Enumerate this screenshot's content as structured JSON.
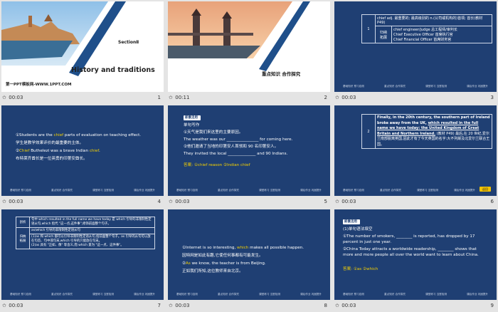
{
  "thumbnails": [
    {
      "time": "00:03",
      "num": "1"
    },
    {
      "time": "00:11",
      "num": "2"
    },
    {
      "time": "00:03",
      "num": "3"
    },
    {
      "time": "00:03",
      "num": "4"
    },
    {
      "time": "00:03",
      "num": "5"
    },
    {
      "time": "00:03",
      "num": "6"
    },
    {
      "time": "00:03",
      "num": "7"
    },
    {
      "time": "00:03",
      "num": "8"
    },
    {
      "time": "00:03",
      "num": "9"
    }
  ],
  "slide1": {
    "section": "SectionⅡ",
    "title": "History and traditions",
    "footer": "第一PPT模板网-WWW.1PPT.COM"
  },
  "slide2": {
    "caption": "重点知识  合作探究"
  },
  "slide3": {
    "row_num": "1",
    "col_label": "归纳\n拓展",
    "line1": "chief adj. 最重要的; 最高级别的   n.(公司或机构的)首领; 首长(教材 P49)",
    "line2": "chief engineer/judge 总工程师/审判长",
    "line3": "Chief Executive Officer 首席执行官",
    "line4": "Chief Financial Officer 首席财务官"
  },
  "slide4": {
    "l1a": "①Students are the ",
    "l1b": "chief",
    "l1c": " parts of evaluation on teaching effect.",
    "l2": "学生是教学效果评价的最重要的主体。",
    "l3a": "②",
    "l3b": "Chief",
    "l3c": " Buthelezi was a brave Indian ",
    "l3d": "chief",
    ".": "",
    "l3e": ".",
    "l4": "布特莱齐酋长是一位英勇的印第安酋长。"
  },
  "slide5": {
    "tag": "即景活用",
    "h": "单句写作",
    "l1": "①天气是我们来这里的主要原因。",
    "l2": "The weather was our ________________ for coming here.",
    "l3": "②他们邀请了当地的印第安人首领和 90 名印第安人。",
    "l4": "They invited the local ______________ and 90 Indians.",
    "ans_label": "答案:",
    "ans": "①chief reason   ②Indian chief"
  },
  "slide6": {
    "row_num": "2",
    "p1": "Finally, in the 20th century, the southern part of Ireland broke away from the UK,",
    "p2": "which resulted in the full name we have today: the United Kingdom of Great Britain and Northern Ireland.",
    "p3": "(教材 P49)",
    "p4": "最后,在 20 世纪,爱尔兰南部脱离英国,因此才有了今天英国的名字:大不列颠及北爱尔兰联合王国。",
    "btn": "返回"
  },
  "slide7": {
    "lab1": "剖析",
    "t1": "句中 which resulted in the full name we have today 是 which 引导的非限制性定语从句,which 指代 \"这一点,这件事\",修饰前面整个句子。",
    "t2": "as/which 引导的非限制性定语从句",
    "lab2": "归纳\n拓展",
    "t3": "(1)as 和 which 都可以引导非限制性定语从句,指前面整个句子。as 引导的从句可以放在句首、句中或句末,which 引导的只能放在句末。",
    "t4": "(2)as 具有 \"正如、像\" 等含义,而 which 意为 \"这一点、这件事\"。"
  },
  "slide8": {
    "l1a": "①Internet is so interesting, ",
    "l1b": "which",
    "l1c": " makes all possible happen.",
    "l2": "因特网是如此有趣,它使任何事都有可能发生。",
    "l3a": "②",
    "l3b": "As",
    "l3c": " we know, the teacher is from Beijing.",
    "l4": "正如我们所知,这位教师来自北京。"
  },
  "slide9": {
    "tag": "即景活用",
    "h": "(1)单句语法填空",
    "l1": "①The number of smokers, ________ is reported, has dropped by 17 percent in just one year.",
    "l2": "②China Today attracts a worldwide readership, ________ shows that more and more people all over the world want to learn about China.",
    "ans_label": "答案:",
    "ans": "①as   ②which"
  },
  "footer_items": [
    "基础知识 预习自测",
    "重点知识 合作探究",
    "课堂练习 当堂检测",
    "课后作业 巩固提升"
  ]
}
